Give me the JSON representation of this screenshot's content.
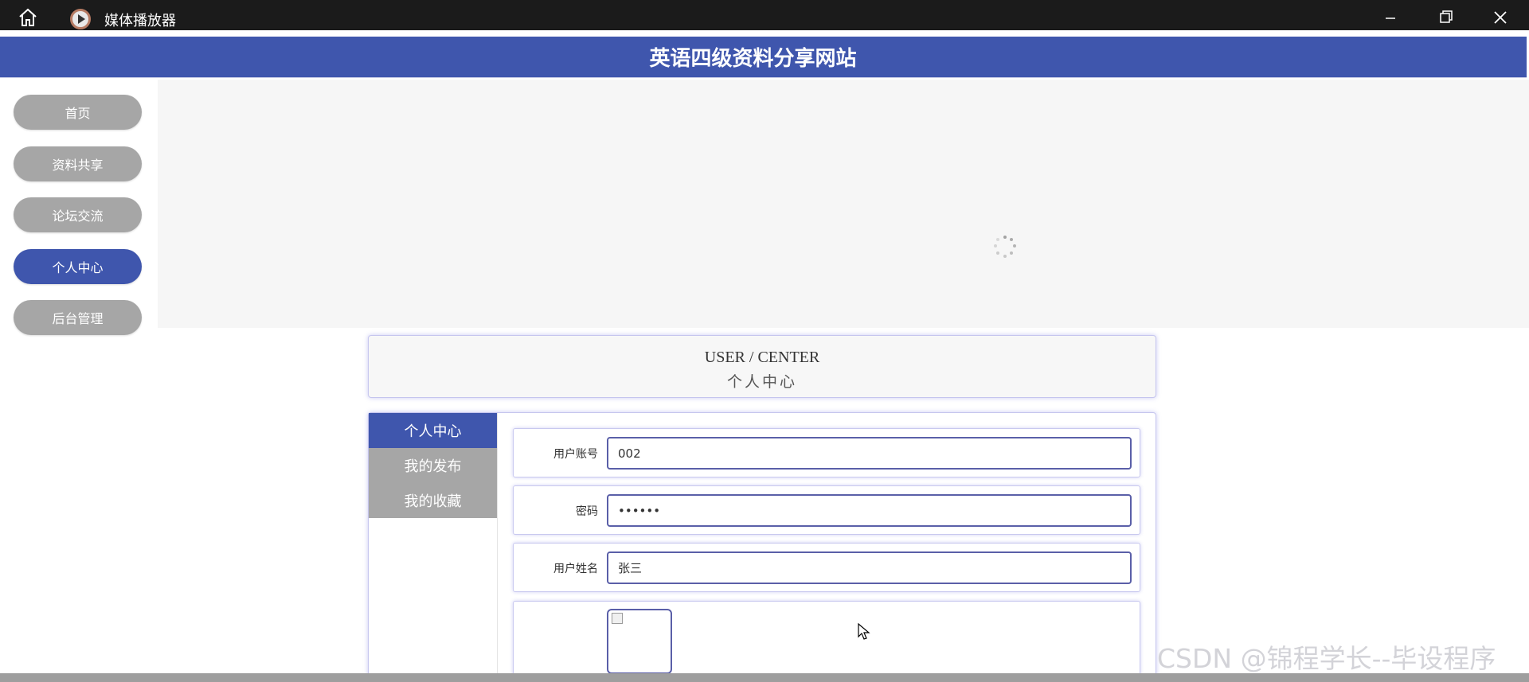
{
  "window": {
    "title": "媒体播放器",
    "home_icon": "home-icon",
    "app_icon": "media-player-icon",
    "controls": [
      "minimize-icon",
      "maximize-icon",
      "close-icon"
    ]
  },
  "header": {
    "title": "英语四级资料分享网站"
  },
  "nav": {
    "items": [
      {
        "label": "首页"
      },
      {
        "label": "资料共享"
      },
      {
        "label": "论坛交流"
      },
      {
        "label": "个人中心",
        "active": true
      },
      {
        "label": "后台管理"
      }
    ]
  },
  "banner": {
    "loading_icon": "loading-spinner-icon"
  },
  "user_center": {
    "title_en": "USER / CENTER",
    "title_cn": "个人中心"
  },
  "side_menu": {
    "items": [
      {
        "label": "个人中心",
        "active": true
      },
      {
        "label": "我的发布"
      },
      {
        "label": "我的收藏"
      }
    ]
  },
  "form": {
    "account": {
      "label": "用户账号",
      "value": "002"
    },
    "password": {
      "label": "密码",
      "value": "••••••"
    },
    "name": {
      "label": "用户姓名",
      "value": "张三"
    },
    "avatar_icon": "broken-image-icon"
  },
  "watermark": "CSDN @锦程学长--毕设程序",
  "colors": {
    "primary": "#3f56ad",
    "inactive": "#a6a6a6",
    "titlebar": "#1b1b1b"
  }
}
